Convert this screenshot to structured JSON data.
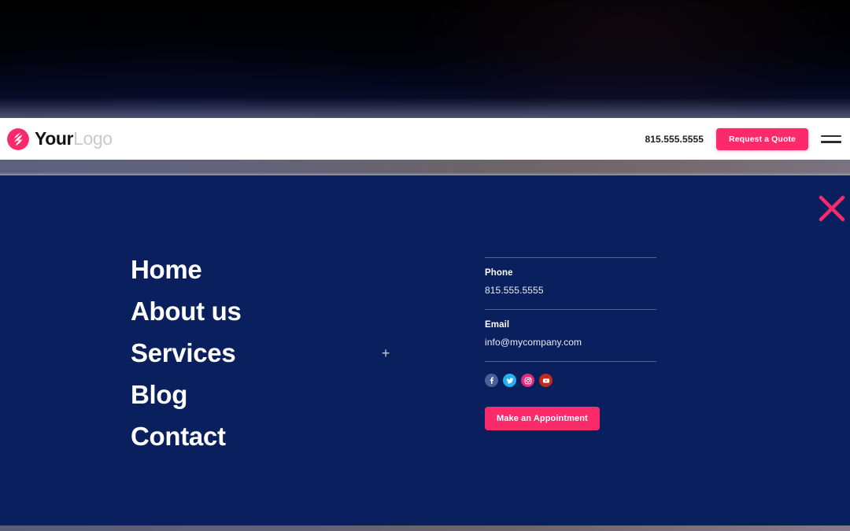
{
  "header": {
    "logo": {
      "primary": "Your",
      "secondary": "Logo",
      "mark": "lightning-bolt-circle-icon"
    },
    "phone": "815.555.5555",
    "quote_button": "Request a Quote",
    "menu_toggle": "hamburger-menu-icon"
  },
  "overlay": {
    "close_label": "close-icon",
    "nav": [
      {
        "label": "Home",
        "expandable": false,
        "expander": ""
      },
      {
        "label": "About us",
        "expandable": false,
        "expander": ""
      },
      {
        "label": "Services",
        "expandable": true,
        "expander": "+"
      },
      {
        "label": "Blog",
        "expandable": false,
        "expander": ""
      },
      {
        "label": "Contact",
        "expandable": false,
        "expander": ""
      }
    ],
    "contact": {
      "phone_label": "Phone",
      "phone_value": "815.555.5555",
      "email_label": "Email",
      "email_value": "info@mycompany.com"
    },
    "socials": [
      {
        "name": "facebook",
        "color": "#4a5f96"
      },
      {
        "name": "twitter",
        "color": "#27b0ee"
      },
      {
        "name": "instagram",
        "color": "#e5297e"
      },
      {
        "name": "youtube",
        "color": "#c32b20"
      }
    ],
    "appointment_button": "Make an Appointment"
  },
  "colors": {
    "navy": "#0a1f5e",
    "pink": "#fb2a6b",
    "white": "#ffffff"
  }
}
